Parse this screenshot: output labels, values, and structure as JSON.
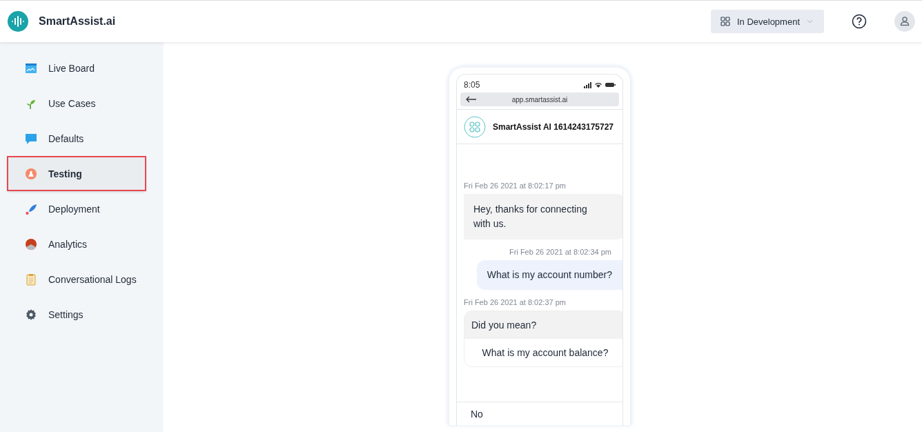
{
  "header": {
    "brand": "SmartAssist.ai",
    "environment": "In Development"
  },
  "sidebar": {
    "items": [
      {
        "label": "Live Board",
        "selected": false
      },
      {
        "label": "Use Cases",
        "selected": false
      },
      {
        "label": "Defaults",
        "selected": false
      },
      {
        "label": "Testing",
        "selected": true
      },
      {
        "label": "Deployment",
        "selected": false
      },
      {
        "label": "Analytics",
        "selected": false
      },
      {
        "label": "Conversational Logs",
        "selected": false
      },
      {
        "label": "Settings",
        "selected": false
      }
    ]
  },
  "phone": {
    "time": "8:05",
    "url": "app.smartassist.ai",
    "bot_name": "SmartAssist AI 1614243175727",
    "messages": [
      {
        "kind": "bot",
        "timestamp": "Fri Feb 26 2021 at 8:02:17 pm",
        "text": "Hey, thanks for connecting with us."
      },
      {
        "kind": "user",
        "timestamp": "Fri Feb 26 2021 at 8:02:34 pm",
        "text": "What is my account number?"
      },
      {
        "kind": "suggestion",
        "timestamp": "Fri Feb 26 2021 at 8:02:37 pm",
        "text": "Did you mean?",
        "option": "What is my account balance?"
      }
    ],
    "quick_reply": "No"
  }
}
